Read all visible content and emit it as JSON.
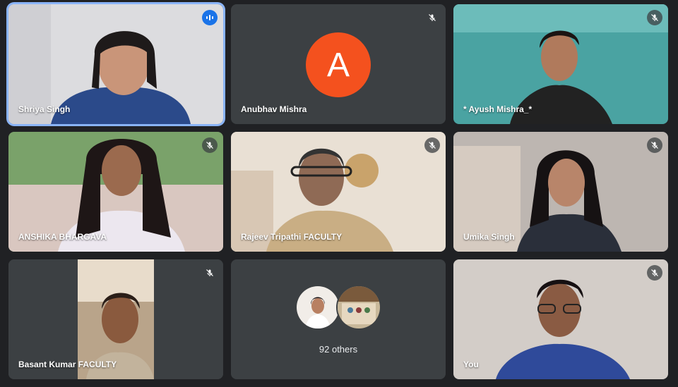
{
  "participants": [
    {
      "name": "Shriya Singh",
      "state": "speaking",
      "bg": "#d8d8dc"
    },
    {
      "name": "Anubhav Mishra",
      "state": "muted",
      "avatar_letter": "A",
      "avatar_color": "#f4511e"
    },
    {
      "name": "* Ayush Mishra_*",
      "state": "muted",
      "bg": "#4fa9a7"
    },
    {
      "name": "ANSHIKA BHARGAVA",
      "state": "muted",
      "bg": "#7aa26a"
    },
    {
      "name": "Rajeev Tripathi FACULTY",
      "state": "muted",
      "bg": "#e7ddd0"
    },
    {
      "name": "Umika Singh",
      "state": "muted",
      "bg": "#b7b0ab"
    },
    {
      "name": "Basant Kumar FACULTY",
      "state": "muted",
      "bg": "#3c4043"
    },
    {
      "name": "You",
      "state": "muted",
      "bg": "#cfc9c4"
    }
  ],
  "others": {
    "label": "92 others"
  },
  "icons": {
    "mic_off": "mic-off-icon",
    "speaking": "audio-level-icon"
  },
  "colors": {
    "background": "#202124",
    "tile": "#3c4043",
    "speaking_border": "#8ab4f8"
  }
}
